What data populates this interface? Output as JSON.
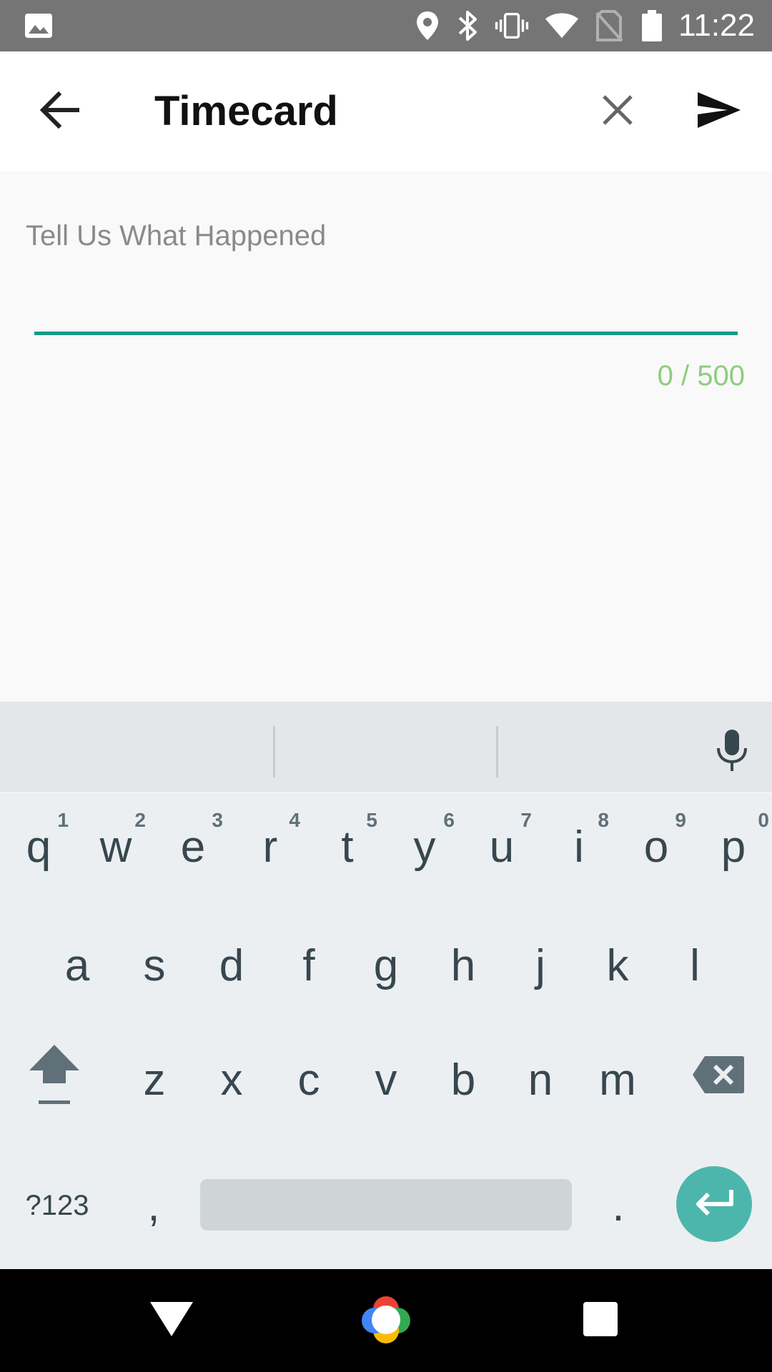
{
  "status_bar": {
    "time": "11:22",
    "icons": [
      "image-icon",
      "location-icon",
      "bluetooth-icon",
      "vibrate-icon",
      "wifi-icon",
      "no-sim-icon",
      "battery-icon"
    ]
  },
  "app_bar": {
    "title": "Timecard",
    "back_icon": "arrow-back-icon",
    "close_icon": "close-icon",
    "send_icon": "send-icon"
  },
  "form": {
    "field_label": "Tell Us What Happened",
    "field_value": "",
    "counter": "0 / 500",
    "accent_color": "#159886",
    "counter_color": "#8dcd7e"
  },
  "keyboard": {
    "row1": [
      {
        "key": "q",
        "hint": "1"
      },
      {
        "key": "w",
        "hint": "2"
      },
      {
        "key": "e",
        "hint": "3"
      },
      {
        "key": "r",
        "hint": "4"
      },
      {
        "key": "t",
        "hint": "5"
      },
      {
        "key": "y",
        "hint": "6"
      },
      {
        "key": "u",
        "hint": "7"
      },
      {
        "key": "i",
        "hint": "8"
      },
      {
        "key": "o",
        "hint": "9"
      },
      {
        "key": "p",
        "hint": "0"
      }
    ],
    "row2": [
      "a",
      "s",
      "d",
      "f",
      "g",
      "h",
      "j",
      "k",
      "l"
    ],
    "row3": [
      "z",
      "x",
      "c",
      "v",
      "b",
      "n",
      "m"
    ],
    "symbols_label": "?123",
    "comma": ",",
    "period": ".",
    "enter_color": "#4db6ac"
  },
  "nav_bar": {
    "icons": [
      "back-triangle-icon",
      "home-icon",
      "recents-icon"
    ]
  }
}
